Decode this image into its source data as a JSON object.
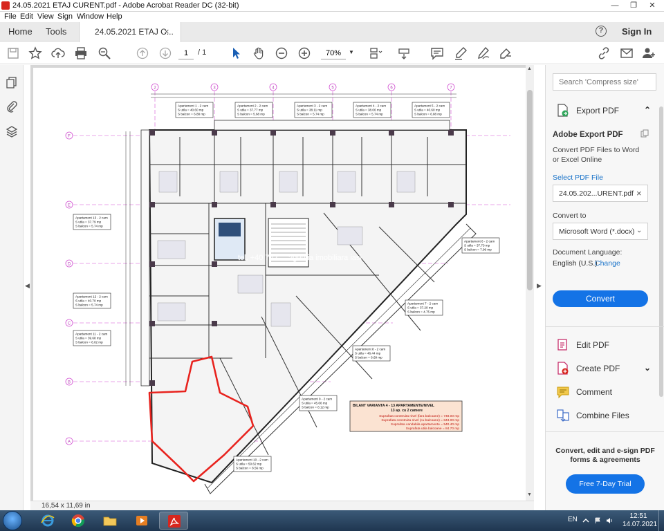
{
  "window": {
    "title": "24.05.2021 ETAJ CURENT.pdf - Adobe Acrobat Reader DC (32-bit)",
    "min": "—",
    "max": "❐",
    "close": "✕"
  },
  "menu": [
    "File",
    "Edit",
    "View",
    "Sign",
    "Window",
    "Help"
  ],
  "tabs": {
    "home": "Home",
    "tools": "Tools",
    "document": "24.05.2021 ETAJ C...",
    "close": "×",
    "help": "?",
    "sign_in": "Sign In"
  },
  "toolbar": {
    "page_current": "1",
    "page_total": "/ 1",
    "zoom": "70%",
    "zoom_caret": "▼"
  },
  "status": {
    "page_size": "16,54 x 11,69 in"
  },
  "rail": {
    "collapse_left": "◀",
    "expand_right": "▶"
  },
  "scroll": {
    "up": "▲",
    "down": "▼"
  },
  "right_pane": {
    "search_placeholder": "Search 'Compress size'",
    "export_header": "Export PDF",
    "export_chevron": "⌃",
    "panel_title": "Adobe Export PDF",
    "panel_desc": "Convert PDF Files to Word or Excel Online",
    "select_label": "Select PDF File",
    "file_name": "24.05.202...URENT.pdf",
    "file_clear": "×",
    "convert_to_label": "Convert to",
    "format_value": "Microsoft Word (*.docx)",
    "format_caret": "⌄",
    "lang_label": "Document Language:",
    "lang_value": "English (U.S.)",
    "lang_change": "Change",
    "convert_btn": "Convert",
    "tools": [
      {
        "label": "Edit PDF",
        "chevron": ""
      },
      {
        "label": "Create PDF",
        "chevron": "⌄"
      },
      {
        "label": "Comment",
        "chevron": ""
      },
      {
        "label": "Combine Files",
        "chevron": ""
      }
    ],
    "promo": "Convert, edit and e-sign PDF forms & agreements",
    "trial_btn": "Free 7-Day Trial"
  },
  "plan": {
    "grid_top": [
      "2",
      "3",
      "4",
      "5",
      "6",
      "7"
    ],
    "grid_left": [
      "F",
      "E",
      "D",
      "C",
      "B",
      "A"
    ],
    "watermark": "tel. +40 742 ...   agentia imobiliara iasi",
    "apartments_top": [
      {
        "name": "Apartament 1 - 2 cam",
        "util": "S utila = 40.60 mp",
        "balcon": "S balcon = 6.88 mp"
      },
      {
        "name": "Apartament 2 - 2 cam",
        "util": "S utila = 37.77 mp",
        "balcon": "S balcon = 5.68 mp"
      },
      {
        "name": "Apartament 3 - 2 cam",
        "util": "S utila = 38.11 mp",
        "balcon": "S balcon = 5.74 mp"
      },
      {
        "name": "Apartament 4 - 2 cam",
        "util": "S utila = 38.06 mp",
        "balcon": "S balcon = 5.74 mp"
      },
      {
        "name": "Apartament 5 - 2 cam",
        "util": "S utila = 40.60 mp",
        "balcon": "S balcon = 6.88 mp"
      }
    ],
    "apartments_left": [
      {
        "name": "Apartament 13 - 2 cam",
        "util": "S utila = 37.79 mp",
        "balcon": "S balcon = 5.74 mp"
      },
      {
        "name": "Apartament 12 - 2 cam",
        "util": "S utila = 40.70 mp",
        "balcon": "S balcon = 5.74 mp"
      },
      {
        "name": "Apartament 11 - 2 cam",
        "util": "S utila = 39.68 mp",
        "balcon": "S balcon = 6.02 mp"
      }
    ],
    "apartments_right": [
      {
        "name": "Apartament 6 - 2 cam",
        "util": "S utila = 37.73 mp",
        "balcon": "S balcon = 7.99 mp"
      },
      {
        "name": "Apartament 7 - 2 cam",
        "util": "S utila = 37.20 mp",
        "balcon": "S balcon = 4.75 mp"
      },
      {
        "name": "Apartament 8 - 2 cam",
        "util": "S utila = 46.44 mp",
        "balcon": "S balcon = 6.69 mp"
      },
      {
        "name": "Apartament 9 - 2 cam",
        "util": "S utila = 45.66 mp",
        "balcon": "S balcon = 8.12 mp"
      },
      {
        "name": "Apartament 10 - 2 cam",
        "util": "S utila = 50.62 mp",
        "balcon": "S balcon = 8.56 mp"
      }
    ],
    "bilant": {
      "title": "BILANT VARIANTA 4 - 13 APARTAMENTE/NIVEL",
      "subtitle": "13 ap. cu 2 camere",
      "rows": [
        "Suprafata construita nivel (fara balcoane) = 748.00 mp",
        "Suprafata construita nivel (cu balcoane) = 843.00 mp",
        "Suprafata vandabila apartamente = 540.40 mp",
        "Suprafata utila balcoane = 84.70 mp"
      ]
    }
  },
  "taskbar": {
    "lang": "EN",
    "time": "12:51",
    "date": "14.07.2021"
  },
  "colors": {
    "accent": "#1473e6",
    "markup_red": "#e8231e",
    "grid_magenta": "#d24fd2"
  }
}
